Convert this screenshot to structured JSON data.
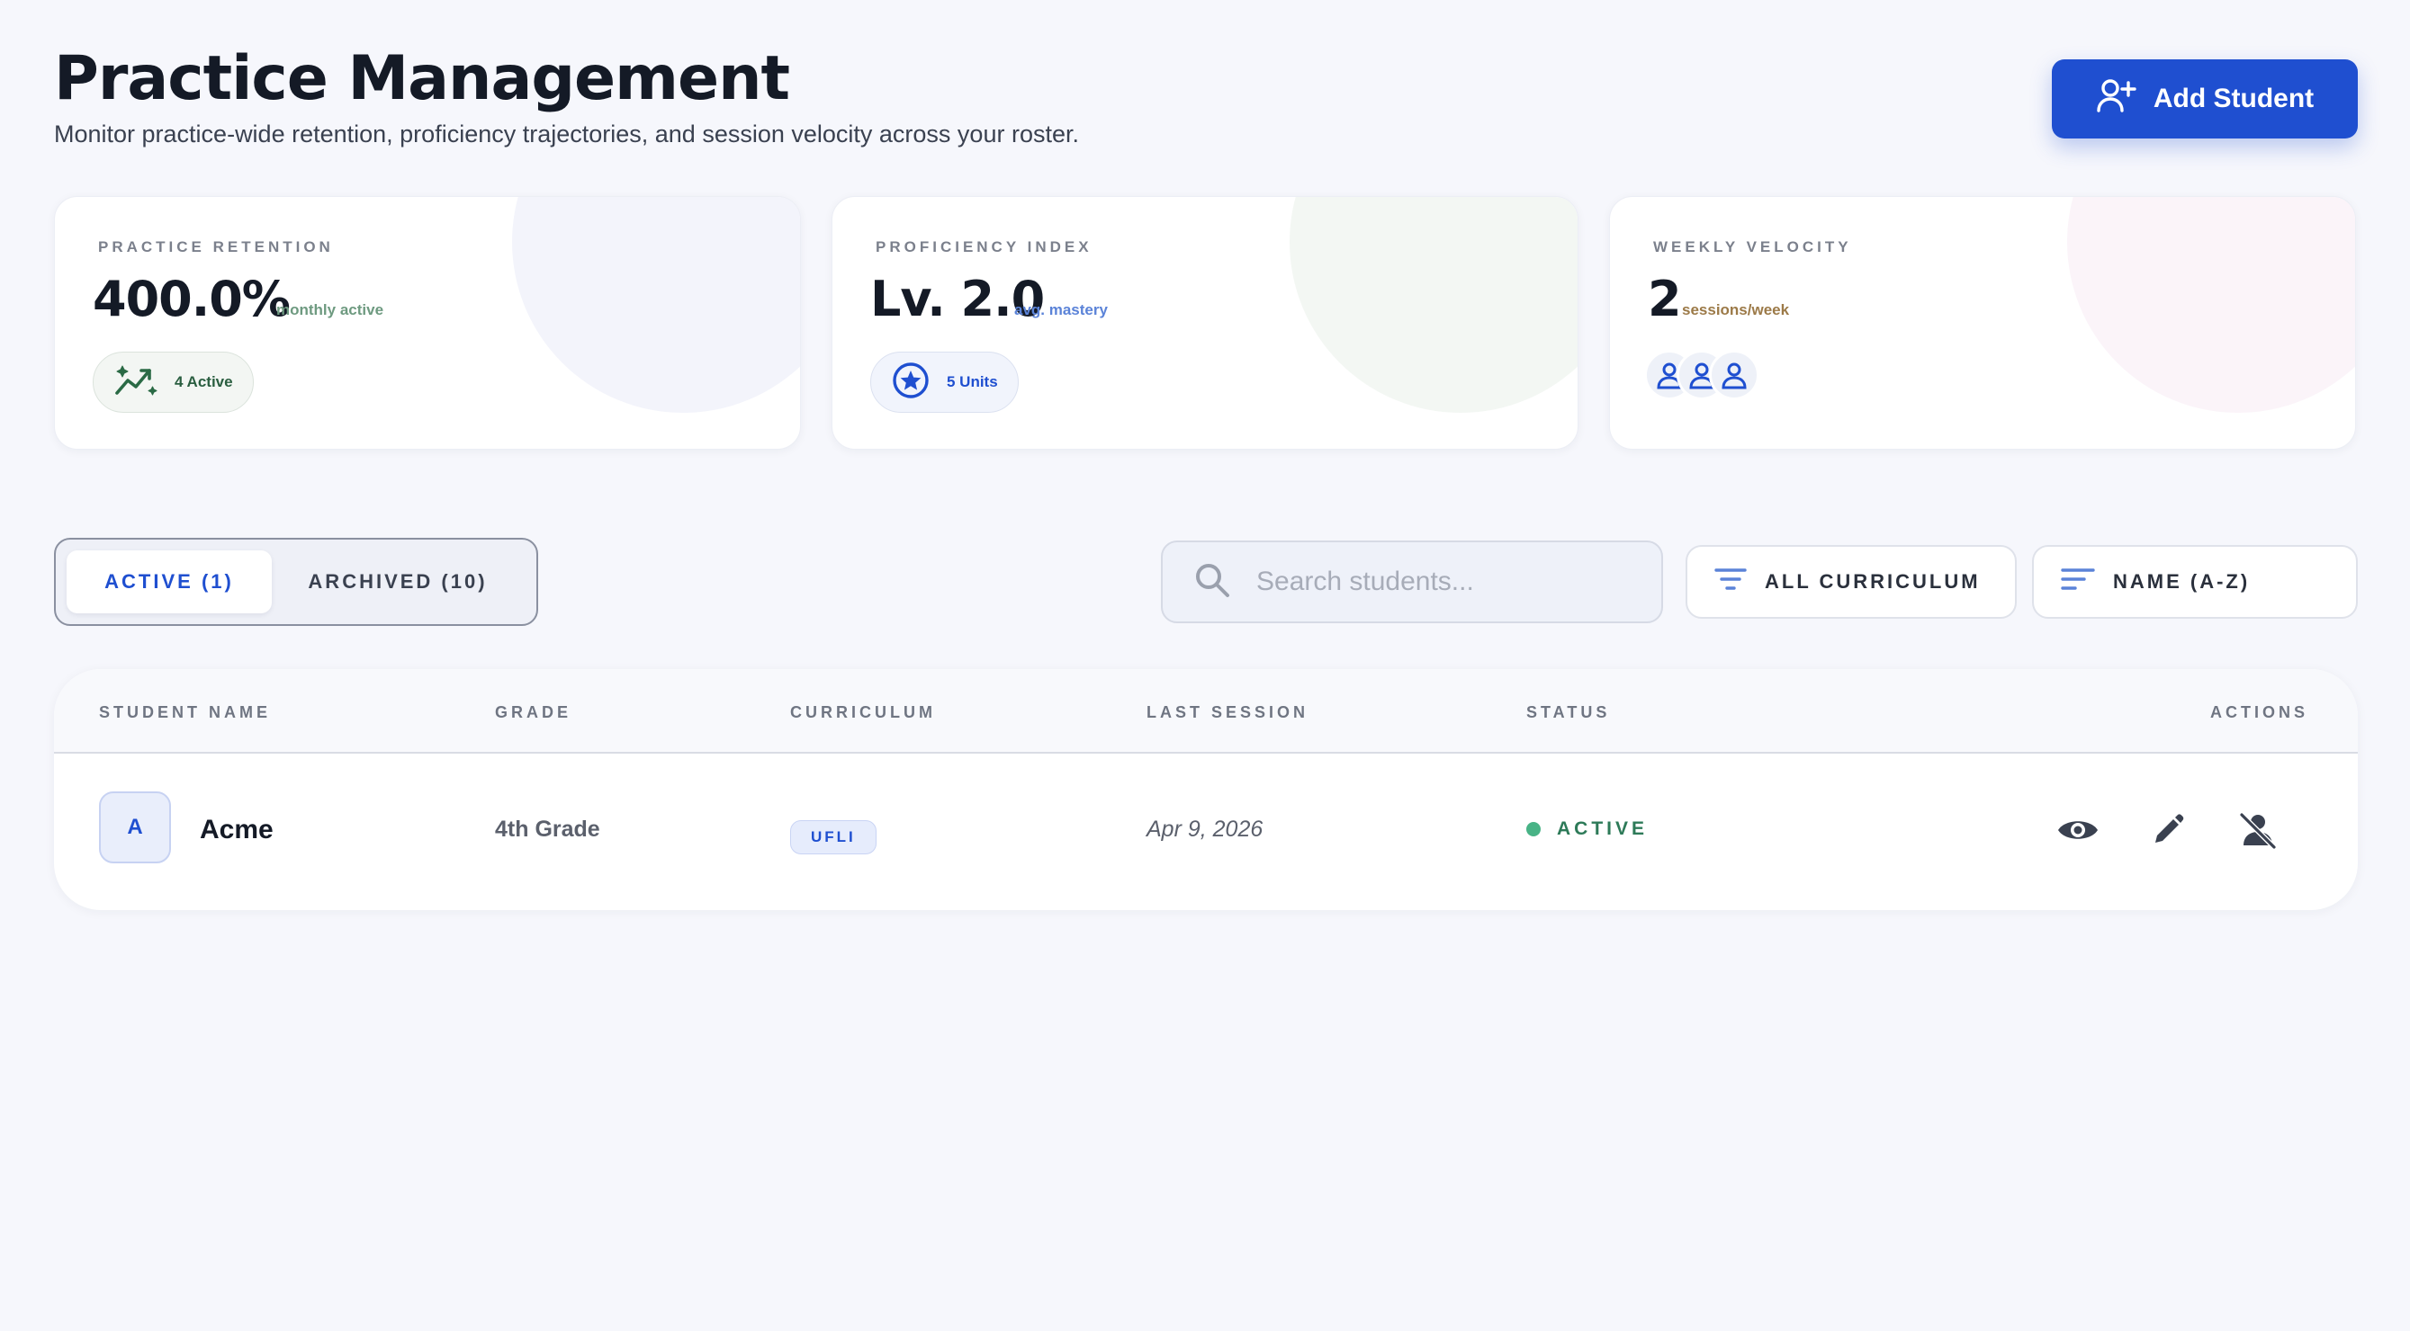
{
  "header": {
    "title": "Practice Management",
    "subtitle": "Monitor practice-wide retention, proficiency trajectories, and session velocity across your roster.",
    "add_button_label": "Add Student"
  },
  "stats": [
    {
      "label": "PRACTICE RETENTION",
      "value": "400.0%",
      "unit": "monthly active",
      "badge": "4 Active",
      "icon": "trending-up-icon"
    },
    {
      "label": "PROFICIENCY INDEX",
      "value": "Lv. 2.0",
      "unit": "avg. mastery",
      "badge": "5 Units",
      "icon": "star-icon"
    },
    {
      "label": "WEEKLY VELOCITY",
      "value": "2",
      "unit": "sessions/week",
      "icon": "users-icon"
    }
  ],
  "tabs": [
    {
      "label": "ACTIVE (1)",
      "active": true
    },
    {
      "label": "ARCHIVED (10)",
      "active": false
    }
  ],
  "search": {
    "placeholder": "Search students..."
  },
  "filters": {
    "curriculum": "ALL CURRICULUM",
    "sort": "NAME (A-Z)"
  },
  "table": {
    "columns": [
      "STUDENT NAME",
      "GRADE",
      "CURRICULUM",
      "LAST SESSION",
      "STATUS",
      "ACTIONS"
    ],
    "rows": [
      {
        "initial": "A",
        "name": "Acme",
        "grade": "4th Grade",
        "curriculum": "UFLI",
        "last_session": "Apr 9, 2026",
        "status": "ACTIVE"
      }
    ]
  },
  "colors": {
    "accent": "#1f4fd0",
    "success": "#2d7a58",
    "text": "#141a26"
  }
}
